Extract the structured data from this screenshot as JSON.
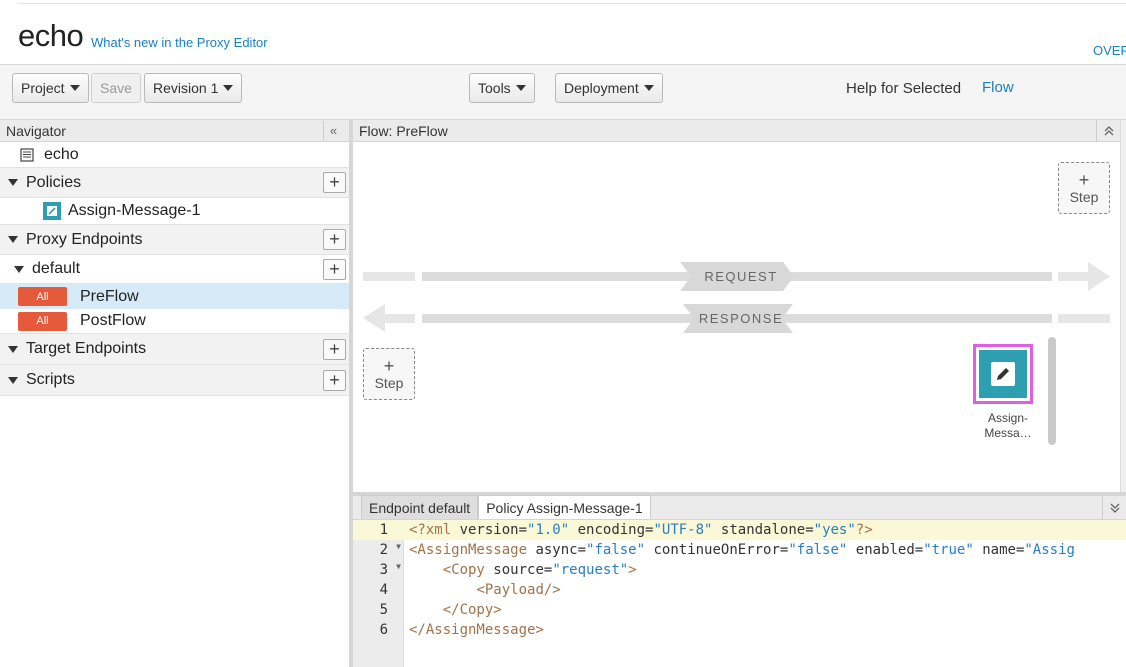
{
  "header": {
    "app_title": "echo",
    "whats_new": "What's new in the Proxy Editor",
    "overview": "OVER"
  },
  "toolbar": {
    "project": "Project",
    "save": "Save",
    "revision": "Revision 1",
    "tools": "Tools",
    "deployment": "Deployment",
    "help_label": "Help for Selected",
    "help_link": "Flow"
  },
  "navigator": {
    "title": "Navigator",
    "collapse": "«",
    "proxy_name": "echo",
    "policies_label": "Policies",
    "policy_item": "Assign-Message-1",
    "proxy_endpoints_label": "Proxy Endpoints",
    "endpoint_default": "default",
    "preflow_badge": "All",
    "preflow_label": "PreFlow",
    "postflow_badge": "All",
    "postflow_label": "PostFlow",
    "target_endpoints_label": "Target Endpoints",
    "scripts_label": "Scripts",
    "plus": "+"
  },
  "flow": {
    "title": "Flow: PreFlow",
    "step_plus": "+",
    "step_label": "Step",
    "request_label": "REQUEST",
    "response_label": "RESPONSE",
    "policy_caption_1": "Assign-",
    "policy_caption_2": "Messa…"
  },
  "editor": {
    "tabs": [
      "Endpoint default",
      "Policy Assign-Message-1"
    ],
    "line_numbers": [
      "1",
      "2",
      "3",
      "4",
      "5",
      "6"
    ],
    "lines": [
      [
        {
          "t": "punct",
          "v": "<?"
        },
        {
          "t": "tag",
          "v": "xml "
        },
        {
          "t": "attr",
          "v": "version="
        },
        {
          "t": "val",
          "v": "\"1.0\""
        },
        {
          "t": "attr",
          "v": " encoding="
        },
        {
          "t": "val",
          "v": "\"UTF-8\""
        },
        {
          "t": "attr",
          "v": " standalone="
        },
        {
          "t": "val",
          "v": "\"yes\""
        },
        {
          "t": "punct",
          "v": "?>"
        }
      ],
      [
        {
          "t": "tag",
          "v": "<AssignMessage"
        },
        {
          "t": "attr",
          "v": " async="
        },
        {
          "t": "val",
          "v": "\"false\""
        },
        {
          "t": "attr",
          "v": " continueOnError="
        },
        {
          "t": "val",
          "v": "\"false\""
        },
        {
          "t": "attr",
          "v": " enabled="
        },
        {
          "t": "val",
          "v": "\"true\""
        },
        {
          "t": "attr",
          "v": " name="
        },
        {
          "t": "val",
          "v": "\"Assig"
        }
      ],
      [
        {
          "t": "attr",
          "v": "    "
        },
        {
          "t": "tag",
          "v": "<Copy"
        },
        {
          "t": "attr",
          "v": " source="
        },
        {
          "t": "val",
          "v": "\"request\""
        },
        {
          "t": "tag",
          "v": ">"
        }
      ],
      [
        {
          "t": "attr",
          "v": "        "
        },
        {
          "t": "tag",
          "v": "<Payload/>"
        }
      ],
      [
        {
          "t": "attr",
          "v": "    "
        },
        {
          "t": "tag",
          "v": "</Copy>"
        }
      ],
      [
        {
          "t": "tag",
          "v": "</AssignMessage>"
        }
      ]
    ]
  },
  "colors": {
    "accent_link": "#1a7fc4",
    "badge_all": "#e55a3b",
    "policy_icon_bg": "#2e9fb0",
    "selection_highlight": "#e05ee0",
    "selected_row": "#d6ebf7"
  }
}
